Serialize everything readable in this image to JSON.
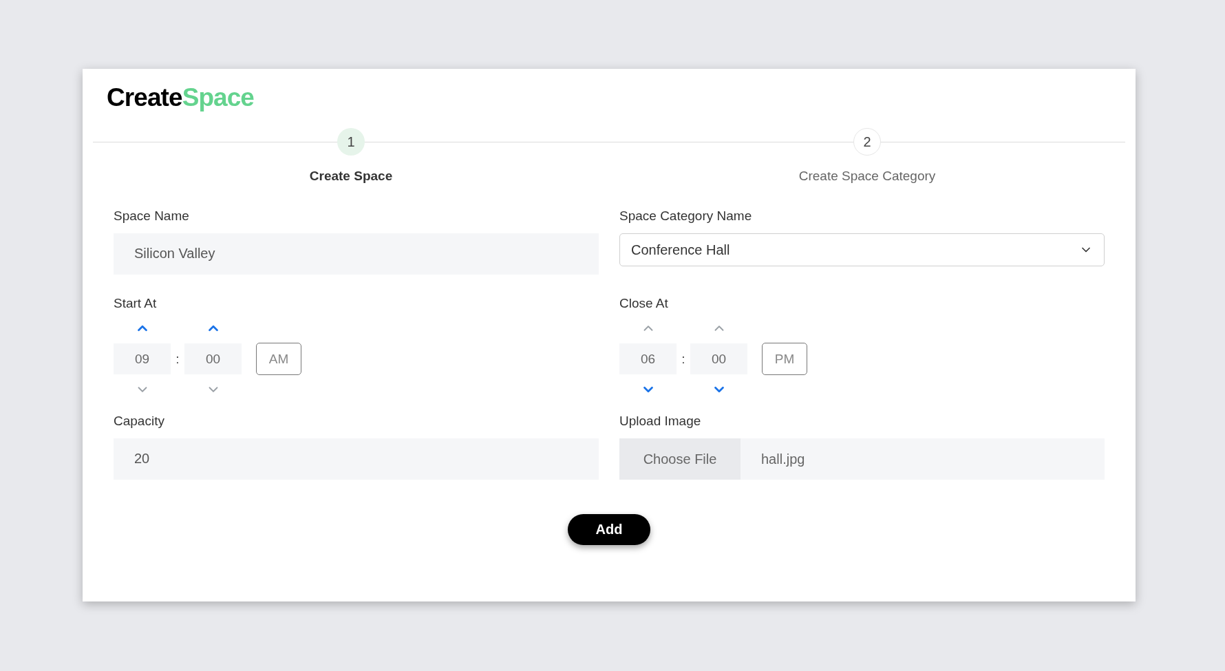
{
  "title": {
    "part_1": "Create",
    "part_2": "Space"
  },
  "steps": [
    {
      "number": "1",
      "label": "Create Space",
      "selected": true
    },
    {
      "number": "2",
      "label": "Create Space Category",
      "selected": false
    }
  ],
  "space_name": {
    "label": "Space Name",
    "value": "Silicon Valley"
  },
  "space_category": {
    "label": "Space Category Name",
    "value": "Conference Hall"
  },
  "start_at": {
    "label": "Start At",
    "hour": "09",
    "separator": ":",
    "minute": "00",
    "period": "AM",
    "hour_up_highlighted": true,
    "hour_down_highlighted": false,
    "minute_up_highlighted": true,
    "minute_down_highlighted": false
  },
  "close_at": {
    "label": "Close At",
    "hour": "06",
    "separator": ":",
    "minute": "00",
    "period": "PM",
    "hour_up_highlighted": false,
    "hour_down_highlighted": true,
    "minute_up_highlighted": false,
    "minute_down_highlighted": true
  },
  "capacity": {
    "label": "Capacity",
    "value": "20"
  },
  "upload_image": {
    "label": "Upload Image",
    "button": "Choose File",
    "file_name": "hall.jpg"
  },
  "submit": "Add"
}
